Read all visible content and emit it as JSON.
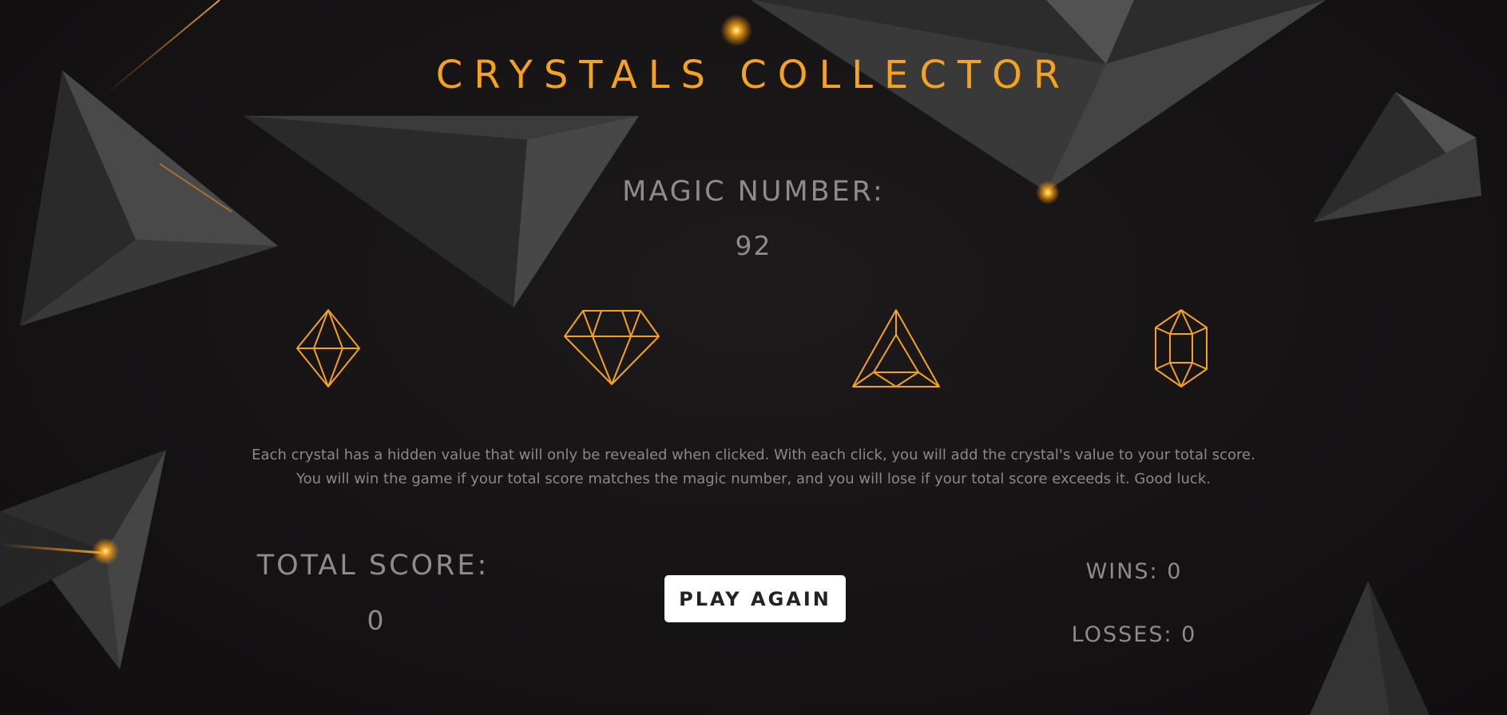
{
  "game": {
    "title": "CRYSTALS COLLECTOR",
    "magic_label": "MAGIC NUMBER:",
    "magic_value": "92",
    "crystals": [
      {
        "name": "octahedron-crystal"
      },
      {
        "name": "diamond-crystal"
      },
      {
        "name": "pyramid-crystal"
      },
      {
        "name": "hexagonal-prism-crystal"
      }
    ],
    "instructions": {
      "line1": "Each crystal has a hidden value that will only be revealed when clicked. With each click, you will add the crystal's value to your total score.",
      "line2": "You will win the game if your total score matches the magic number, and you will lose if your total score exceeds it. Good luck."
    },
    "score_label": "TOTAL SCORE:",
    "score_value": "0",
    "play_again_label": "PLAY AGAIN",
    "wins_text": "WINS: 0",
    "losses_text": "LOSSES: 0"
  },
  "colors": {
    "accent": "#f6a21e",
    "text_muted": "#8d8b8c",
    "background": "#151314",
    "button_bg": "#ffffff",
    "button_text": "#222222"
  }
}
